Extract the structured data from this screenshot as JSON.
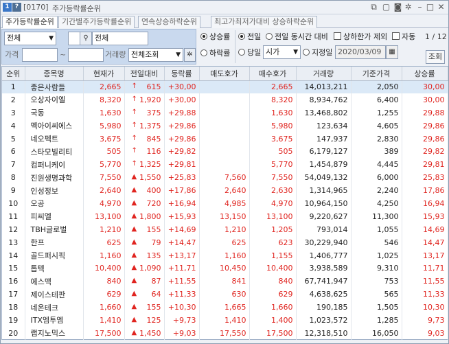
{
  "title_bar": {
    "badge1": "1",
    "badge2": "?",
    "code": "[0170]",
    "title": "주가등락률순위",
    "colors": {
      "badge1": "#3a77c8",
      "badge2": "#4f6f94"
    }
  },
  "tabs": [
    {
      "label": "주가등락률순위",
      "active": true
    },
    {
      "label": "기간별주가등락률순위",
      "active": false
    },
    {
      "label": "연속상승하락순위",
      "active": false
    },
    {
      "label": "최고가최저가대비 상승하락순위",
      "active": false
    }
  ],
  "filters": {
    "market_select": "전체",
    "search_value": "전체",
    "price_label": "가격",
    "price_from": "",
    "tilde": "~",
    "price_to": "",
    "volume_label": "거래량",
    "volume_select": "전체조회",
    "rise_label": "상승률",
    "fall_label": "하락률",
    "prev_day_label": "전일",
    "prev_same_time_label": "전일 동시간 대비",
    "limit_excl_label": "상하한가 제외",
    "auto_label": "자동",
    "page_info": "1 / 12",
    "today_label": "당일",
    "time_select": "시가",
    "date_label": "지정일",
    "date_value": "2020/03/09",
    "search_button": "조회"
  },
  "table": {
    "headers": [
      "순위",
      "종목명",
      "현재가",
      "전일대비",
      "등락률",
      "매도호가",
      "매수호가",
      "거래량",
      "기준가격",
      "상승률"
    ],
    "rows": [
      [
        "1",
        "좋은사람들",
        "2,665",
        "615",
        "+30,00",
        "",
        "2,665",
        "14,013,211",
        "2,050",
        "30,00"
      ],
      [
        "2",
        "오상자이엘",
        "8,320",
        "1,920",
        "+30,00",
        "",
        "8,320",
        "8,934,762",
        "6,400",
        "30,00"
      ],
      [
        "3",
        "국동",
        "1,630",
        "375",
        "+29,88",
        "",
        "1,630",
        "13,468,802",
        "1,255",
        "29,88"
      ],
      [
        "4",
        "멕아이씨에스",
        "5,980",
        "1,375",
        "+29,86",
        "",
        "5,980",
        "123,634",
        "4,605",
        "29,86"
      ],
      [
        "5",
        "네오펙트",
        "3,675",
        "845",
        "+29,86",
        "",
        "3,675",
        "147,937",
        "2,830",
        "29,86"
      ],
      [
        "6",
        "스타모빌리티",
        "505",
        "116",
        "+29,82",
        "",
        "505",
        "6,179,127",
        "389",
        "29,82"
      ],
      [
        "7",
        "컴퍼니케이",
        "5,770",
        "1,325",
        "+29,81",
        "",
        "5,770",
        "1,454,879",
        "4,445",
        "29,81"
      ],
      [
        "8",
        "진원생명과학",
        "7,550",
        "1,550",
        "+25,83",
        "7,560",
        "7,550",
        "54,049,132",
        "6,000",
        "25,83"
      ],
      [
        "9",
        "인성정보",
        "2,640",
        "400",
        "+17,86",
        "2,640",
        "2,630",
        "1,314,965",
        "2,240",
        "17,86"
      ],
      [
        "10",
        "오공",
        "4,970",
        "720",
        "+16,94",
        "4,985",
        "4,970",
        "10,964,150",
        "4,250",
        "16,94"
      ],
      [
        "11",
        "피씨엘",
        "13,100",
        "1,800",
        "+15,93",
        "13,150",
        "13,100",
        "9,220,627",
        "11,300",
        "15,93"
      ],
      [
        "12",
        "TBH글로벌",
        "1,210",
        "155",
        "+14,69",
        "1,210",
        "1,205",
        "793,014",
        "1,055",
        "14,69"
      ],
      [
        "13",
        "한프",
        "625",
        "79",
        "+14,47",
        "625",
        "623",
        "30,229,940",
        "546",
        "14,47"
      ],
      [
        "14",
        "골드퍼시픽",
        "1,160",
        "135",
        "+13,17",
        "1,160",
        "1,155",
        "1,406,777",
        "1,025",
        "13,17"
      ],
      [
        "15",
        "톱텍",
        "10,400",
        "1,090",
        "+11,71",
        "10,450",
        "10,400",
        "3,938,589",
        "9,310",
        "11,71"
      ],
      [
        "16",
        "에스맥",
        "840",
        "87",
        "+11,55",
        "841",
        "840",
        "67,741,947",
        "753",
        "11,55"
      ],
      [
        "17",
        "제이스테판",
        "629",
        "64",
        "+11,33",
        "630",
        "629",
        "4,638,625",
        "565",
        "11,33"
      ],
      [
        "18",
        "네온테크",
        "1,660",
        "155",
        "+10,30",
        "1,665",
        "1,660",
        "190,185",
        "1,505",
        "10,30"
      ],
      [
        "19",
        "ITX엠투엠",
        "1,410",
        "125",
        "+9,73",
        "1,410",
        "1,400",
        "1,023,572",
        "1,285",
        "9,73"
      ],
      [
        "20",
        "랩지노믹스",
        "17,500",
        "1,450",
        "+9,03",
        "17,550",
        "17,500",
        "12,318,510",
        "16,050",
        "9,03"
      ]
    ],
    "arrow_type": [
      "upper-limit",
      "upper-limit",
      "upper-limit",
      "upper-limit",
      "upper-limit",
      "upper-limit",
      "upper-limit",
      "up",
      "up",
      "up",
      "up",
      "up",
      "up",
      "up",
      "up",
      "up",
      "up",
      "up",
      "up",
      "up"
    ],
    "selected_row": 0
  },
  "colors": {
    "up": "#e0241f",
    "filter_panel": "#c9d9ee",
    "selected_row": "#dbe9f7"
  }
}
